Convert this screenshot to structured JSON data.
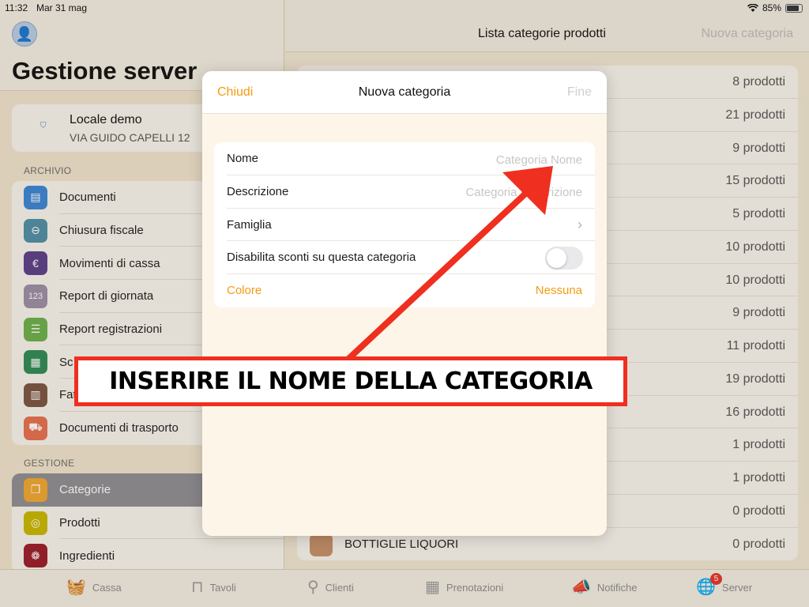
{
  "status_bar": {
    "time": "11:32",
    "date": "Mar 31 mag",
    "battery": "85%",
    "wifi_icon": "wifi-icon"
  },
  "sidebar": {
    "title": "Gestione server",
    "venue": {
      "name": "Locale demo",
      "address": "VIA GUIDO CAPELLI 12"
    },
    "sections": [
      {
        "header": "ARCHIVIO",
        "items": [
          {
            "label": "Documenti",
            "icon": "folder-icon",
            "color": "#3a86d8"
          },
          {
            "label": "Chiusura fiscale",
            "icon": "minus-circle-icon",
            "color": "#4f8fa8"
          },
          {
            "label": "Movimenti di cassa",
            "icon": "euro-icon",
            "color": "#5b3f8a"
          },
          {
            "label": "Report di giornata",
            "icon": "numbers-icon",
            "color": "#9b8fa8"
          },
          {
            "label": "Report registrazioni",
            "icon": "list-icon",
            "color": "#6ab04c"
          },
          {
            "label": "Sc",
            "icon": "register-icon",
            "color": "#2e8b57"
          },
          {
            "label": "Fat",
            "icon": "document-icon",
            "color": "#7a5544"
          },
          {
            "label": "Documenti di trasporto",
            "icon": "truck-icon",
            "color": "#e76f51"
          }
        ]
      },
      {
        "header": "GESTIONE",
        "items": [
          {
            "label": "Categorie",
            "icon": "categories-icon",
            "color": "#f0a830",
            "active": true
          },
          {
            "label": "Prodotti",
            "icon": "product-icon",
            "color": "#c9b800"
          },
          {
            "label": "Ingredienti",
            "icon": "ingredients-icon",
            "color": "#9b1c2c"
          }
        ]
      }
    ]
  },
  "main": {
    "title": "Lista categorie prodotti",
    "new_action": "Nuova categoria",
    "rows": [
      {
        "name": "",
        "count": "8 prodotti"
      },
      {
        "name": "",
        "count": "21 prodotti"
      },
      {
        "name": "",
        "count": "9 prodotti"
      },
      {
        "name": "",
        "count": "15 prodotti"
      },
      {
        "name": "",
        "count": "5 prodotti"
      },
      {
        "name": "",
        "count": "10 prodotti"
      },
      {
        "name": "",
        "count": "10 prodotti"
      },
      {
        "name": "",
        "count": "9 prodotti"
      },
      {
        "name": "",
        "count": "11 prodotti"
      },
      {
        "name": "",
        "count": "19 prodotti"
      },
      {
        "name": "",
        "count": "16 prodotti"
      },
      {
        "name": "",
        "count": "1 prodotti"
      },
      {
        "name": "",
        "count": "1 prodotti"
      },
      {
        "name": "",
        "count": "0 prodotti"
      },
      {
        "name": "BOTTIGLIE LIQUORI",
        "count": "0 prodotti",
        "swatch": "#c4906a"
      }
    ]
  },
  "modal": {
    "close_label": "Chiudi",
    "title": "Nuova categoria",
    "done_label": "Fine",
    "fields": {
      "name_label": "Nome",
      "name_placeholder": "Categoria Nome",
      "description_label": "Descrizione",
      "description_placeholder": "Categoria Descrizione",
      "family_label": "Famiglia",
      "disable_discounts_label": "Disabilita sconti su questa categoria",
      "disable_discounts_value": false,
      "color_label": "Colore",
      "color_value": "Nessuna"
    }
  },
  "annotation": {
    "text": "INSERIRE IL NOME DELLA CATEGORIA",
    "color": "#ef2f1f"
  },
  "tabbar": {
    "tabs": [
      {
        "label": "Cassa",
        "icon": "basket-icon"
      },
      {
        "label": "Tavoli",
        "icon": "table-icon"
      },
      {
        "label": "Clienti",
        "icon": "person-icon"
      },
      {
        "label": "Prenotazioni",
        "icon": "calendar-icon"
      },
      {
        "label": "Notifiche",
        "icon": "megaphone-icon"
      },
      {
        "label": "Server",
        "icon": "globe-icon",
        "badge": "5"
      }
    ]
  },
  "colors": {
    "accent": "#f39c12",
    "background": "#efe6d3"
  }
}
